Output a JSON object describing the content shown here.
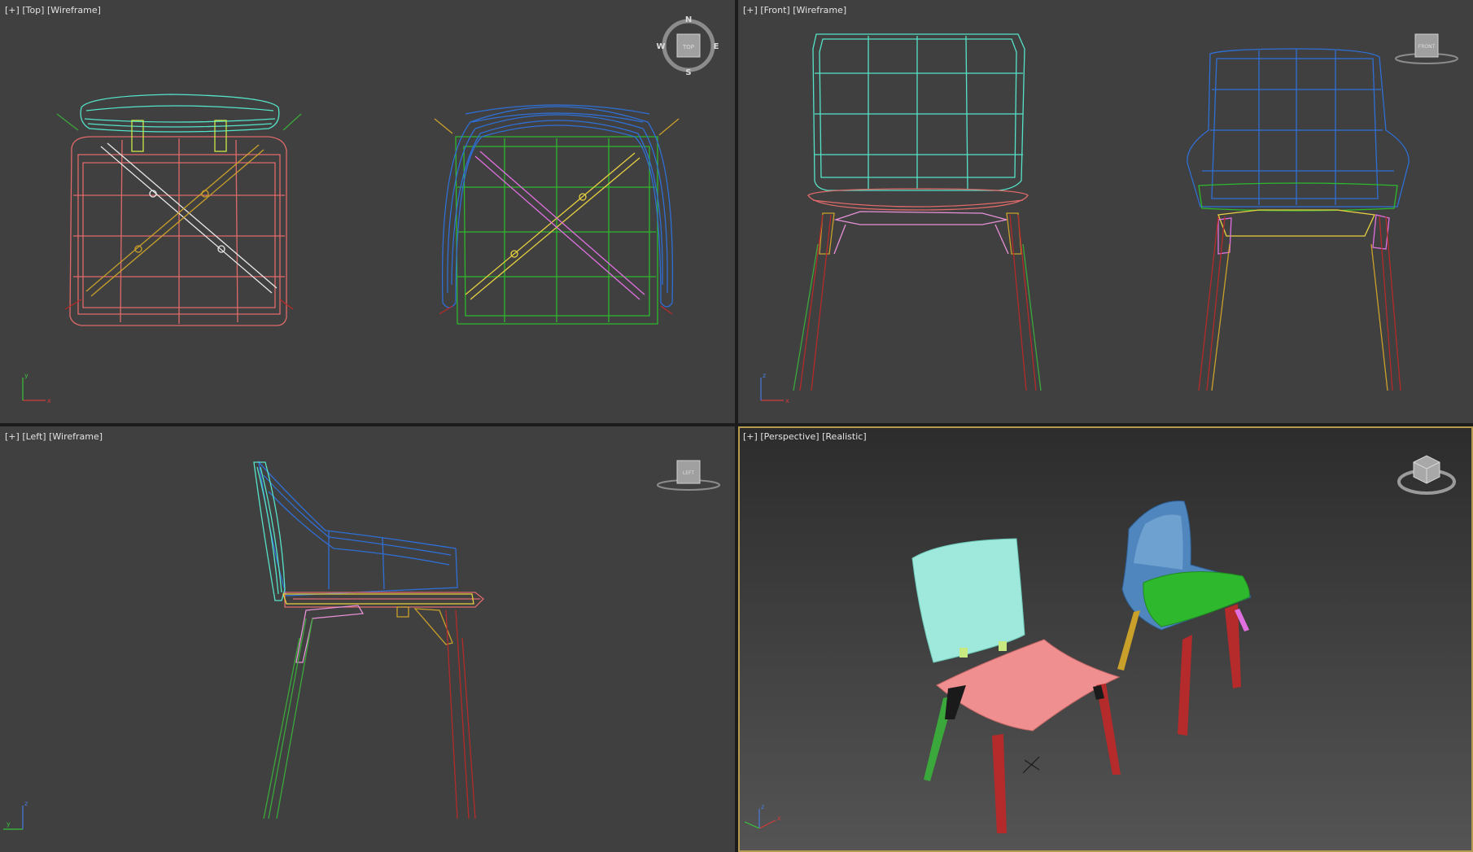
{
  "viewports": {
    "top": {
      "plus": "[+]",
      "view": "[Top]",
      "shading": "[Wireframe]"
    },
    "front": {
      "plus": "[+]",
      "view": "[Front]",
      "shading": "[Wireframe]"
    },
    "left": {
      "plus": "[+]",
      "view": "[Left]",
      "shading": "[Wireframe]"
    },
    "perspective": {
      "plus": "[+]",
      "view": "[Perspective]",
      "shading": "[Realistic]"
    }
  },
  "viewcube": {
    "top_face": "TOP",
    "front_face": "FRONT",
    "left_face": "LEFT",
    "compass": {
      "n": "N",
      "s": "S",
      "e": "E",
      "w": "W"
    }
  },
  "axis_labels": {
    "x": "x",
    "y": "y",
    "z": "z"
  },
  "colors": {
    "viewport_bg": "#404040",
    "active_border": "#b69a50",
    "backrest_cyan": "#55e3c8",
    "seat_red": "#e06a6a",
    "legs_red": "#b52a2a",
    "legs_green": "#3aa83a",
    "armchair_blue": "#2f6fd6",
    "seat_green": "#2db82d",
    "brace_pink": "#e890d8",
    "brace_yellow": "#c9a02a"
  }
}
